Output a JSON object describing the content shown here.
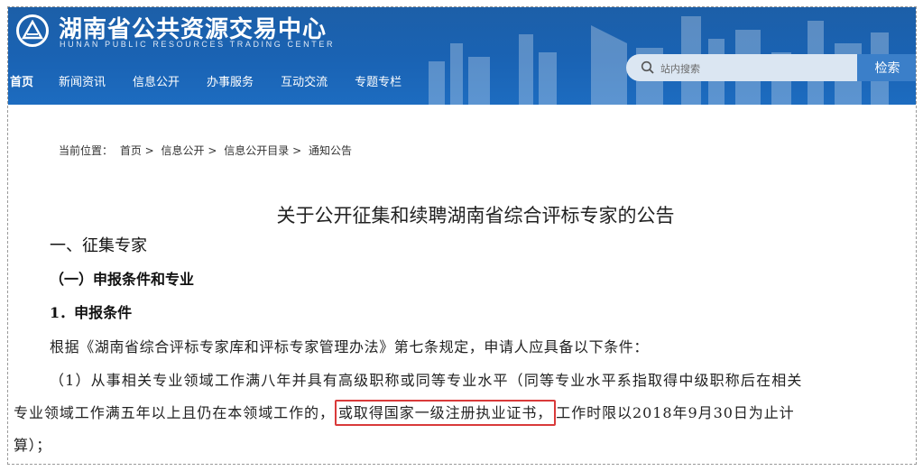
{
  "header": {
    "title": "湖南省公共资源交易中心",
    "subtitle": "HUNAN PUBLIC RESOURCES TRADING CENTER",
    "brand_color": "#1a63b4"
  },
  "nav": {
    "items": [
      {
        "label": "首页",
        "active": true
      },
      {
        "label": "新闻资讯"
      },
      {
        "label": "信息公开"
      },
      {
        "label": "办事服务"
      },
      {
        "label": "互动交流"
      },
      {
        "label": "专题专栏"
      }
    ]
  },
  "search": {
    "placeholder": "站内搜索",
    "button_label": "检索"
  },
  "breadcrumb": {
    "prefix": "当前位置：",
    "items": [
      "首页 >",
      "信息公开 >",
      "信息公开目录 >",
      "通知公告"
    ]
  },
  "article": {
    "title": "关于公开征集和续聘湖南省综合评标专家的公告",
    "section1": "一、征集专家",
    "section1_1": "（一）申报条件和专业",
    "item1": "1．申报条件",
    "para1": "根据《湖南省综合评标专家库和评标专家管理办法》第七条规定，申请人应具备以下条件：",
    "para2_line1": "（1）从事相关专业领域工作满八年并具有高级职称或同等专业水平（同等专业水平系指取得中级职称后在相关",
    "para2_line2_before": "专业领域工作满五年以上且仍在本领域工作的，",
    "para2_highlight": "或取得国家一级注册执业证书，",
    "para2_line2_after": "工作时限以2018年9月30日为止计",
    "para2_line3": "算）；",
    "highlight_color": "#d93a3a"
  }
}
